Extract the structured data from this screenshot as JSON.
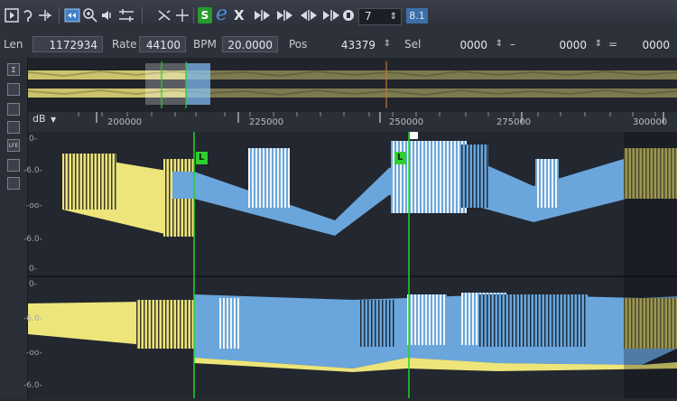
{
  "toolbar": {
    "subset_value": "7",
    "version": "8.1",
    "s_label": "S",
    "e_label": "e",
    "x_label": "X"
  },
  "info": {
    "len_label": "Len",
    "len_value": "1172934",
    "rate_label": "Rate",
    "rate_value": "44100",
    "bpm_label": "BPM",
    "bpm_value": "20.0000",
    "pos_label": "Pos",
    "pos_value": "43379",
    "sel_label": "Sel",
    "sel_start": "0000",
    "sel_dash": "–",
    "sel_end": "0000",
    "sel_eq": "=",
    "sel_len": "0000"
  },
  "left_strip": {
    "sigma": "Σ",
    "lfe": "LFE"
  },
  "ruler": {
    "db_label": "dB",
    "ticks": [
      "200000",
      "225000",
      "250000",
      "275000",
      "300000"
    ]
  },
  "db_scale": {
    "ch1": [
      "0-",
      "-6.0-",
      "-oo-",
      "-6.0-",
      "0-"
    ],
    "ch2": [
      "0-",
      "-6.0-",
      "-oo-",
      "-6.0-"
    ]
  },
  "markers": {
    "loop_label_1": "L",
    "loop_label_2": "L"
  },
  "colors": {
    "selection_blue": "#6aa6dc",
    "waveform_yellow": "#ede57a",
    "marker_green": "#22d22a"
  }
}
